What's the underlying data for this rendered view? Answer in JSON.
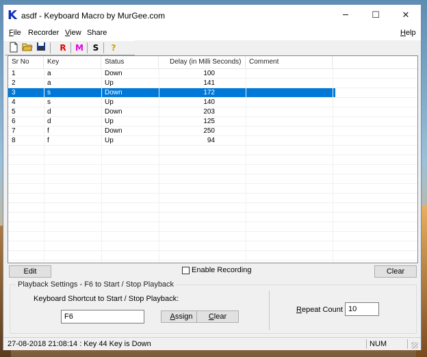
{
  "window": {
    "title": "asdf - Keyboard Macro by MurGee.com",
    "icon_letter": "K",
    "controls": {
      "minimize": "─",
      "maximize": "☐",
      "close": "✕"
    }
  },
  "menu": {
    "file": "F",
    "file_rest": "ile",
    "recorder": "Recorder",
    "view": "V",
    "view_rest": "iew",
    "share": "Share",
    "help": "H",
    "help_rest": "elp"
  },
  "toolbar": {
    "new_icon": "new-file-icon",
    "open_icon": "open-folder-icon",
    "save_icon": "save-disk-icon",
    "r_label": "R",
    "r_color": "#e00000",
    "m_label": "M",
    "m_color": "#e000e0",
    "s_label": "S",
    "s_color": "#000000",
    "help_label": "?",
    "help_color": "#c8a000"
  },
  "table": {
    "columns": [
      "Sr No",
      "Key",
      "Status",
      "Delay (in Milli Seconds)",
      "Comment"
    ],
    "selected_index": 2,
    "selection_color": "#0078d7",
    "rows": [
      {
        "sr": "1",
        "key": "a",
        "status": "Down",
        "delay": "100",
        "comment": ""
      },
      {
        "sr": "2",
        "key": "a",
        "status": "Up",
        "delay": "141",
        "comment": ""
      },
      {
        "sr": "3",
        "key": "s",
        "status": "Down",
        "delay": "172",
        "comment": ""
      },
      {
        "sr": "4",
        "key": "s",
        "status": "Up",
        "delay": "140",
        "comment": ""
      },
      {
        "sr": "5",
        "key": "d",
        "status": "Down",
        "delay": "203",
        "comment": ""
      },
      {
        "sr": "6",
        "key": "d",
        "status": "Up",
        "delay": "125",
        "comment": ""
      },
      {
        "sr": "7",
        "key": "f",
        "status": "Down",
        "delay": "250",
        "comment": ""
      },
      {
        "sr": "8",
        "key": "f",
        "status": "Up",
        "delay": "94",
        "comment": ""
      }
    ]
  },
  "controls": {
    "edit_button": "Edit",
    "enable_recording": "Enable Recording",
    "enable_recording_checked": false,
    "clear_button": "Clear"
  },
  "playback": {
    "group_title": "Playback Settings - F6 to Start / Stop Playback",
    "shortcut_label": "Keyboard Shortcut to Start / Stop Playback:",
    "shortcut_value": "F6",
    "assign_button_u": "A",
    "assign_button_rest": "ssign",
    "clear_button_u": "C",
    "clear_button_rest": "lear",
    "repeat_label_u": "R",
    "repeat_label_rest": "epeat Count :",
    "repeat_value": "10"
  },
  "status": {
    "message": "27-08-2018 21:08:14 : Key 44 Key is Down",
    "num": "NUM"
  }
}
